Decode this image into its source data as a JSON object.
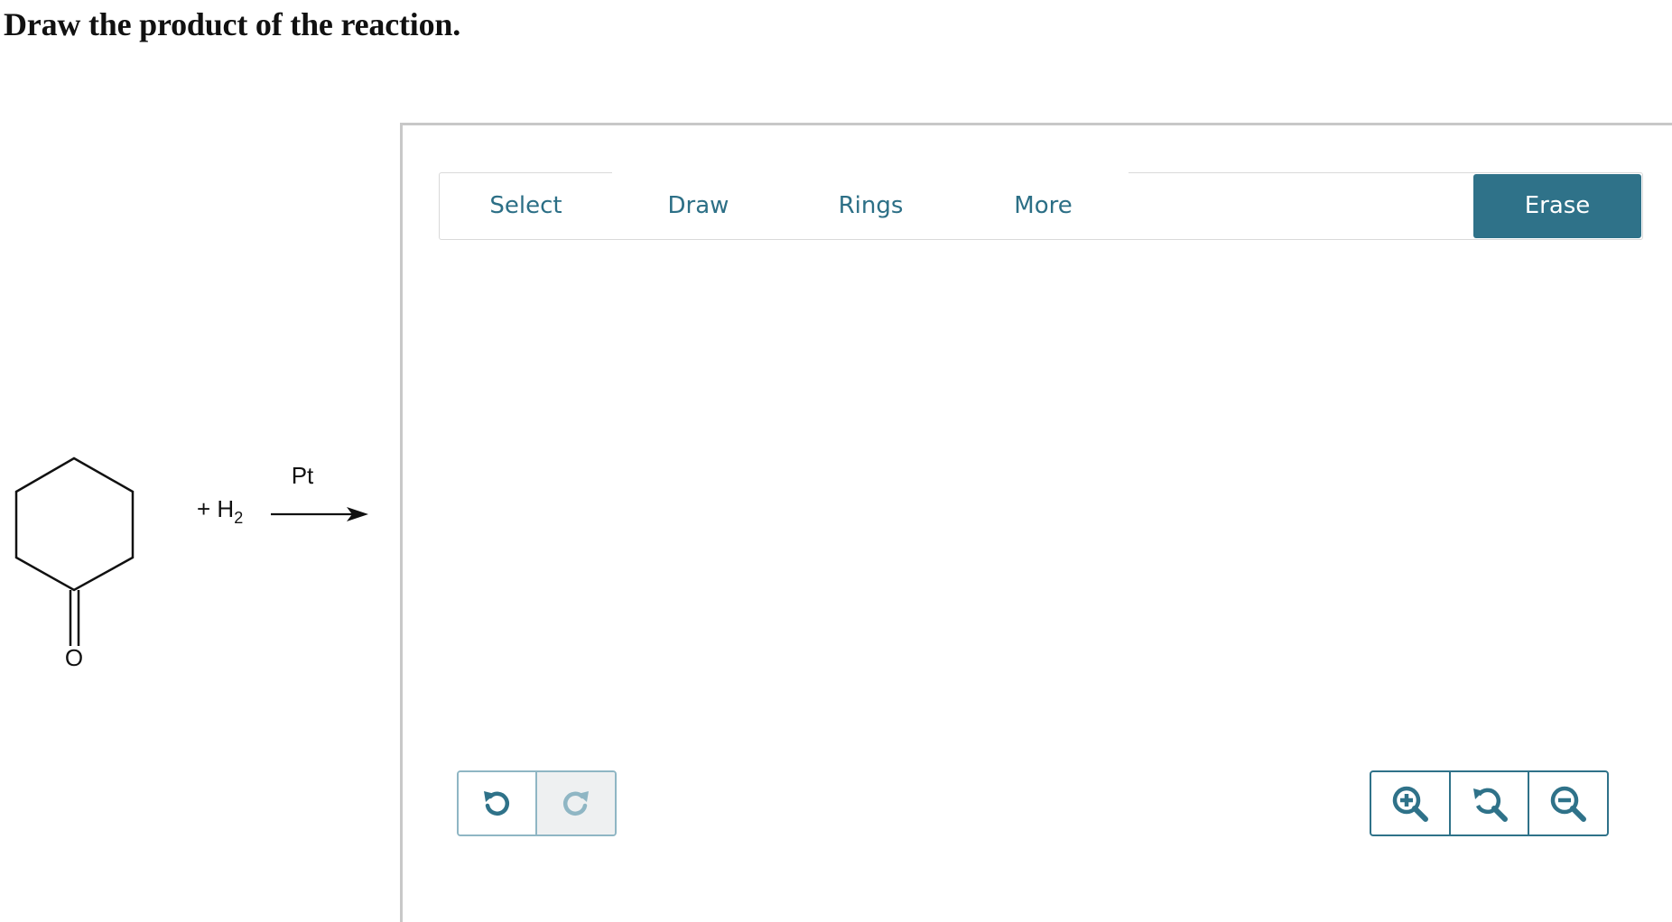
{
  "question": {
    "text": "Draw the product of the reaction."
  },
  "reaction": {
    "reagent_prefix": "+ H",
    "reagent_subscript": "2",
    "catalyst": "Pt",
    "reactant_atom_label": "O"
  },
  "toolbar": {
    "tabs": [
      {
        "label": "Select"
      },
      {
        "label": "Draw"
      },
      {
        "label": "Rings"
      },
      {
        "label": "More"
      }
    ],
    "erase_label": "Erase"
  },
  "history": {
    "undo_icon": "undo-icon",
    "redo_icon": "redo-icon",
    "redo_enabled": false
  },
  "zoom": {
    "zoom_in_icon": "zoom-in-icon",
    "zoom_reset_icon": "zoom-reset-icon",
    "zoom_out_icon": "zoom-out-icon"
  },
  "colors": {
    "accent": "#2f7289",
    "tab_text": "#2c6f86",
    "disabled": "#8fb6c4"
  }
}
